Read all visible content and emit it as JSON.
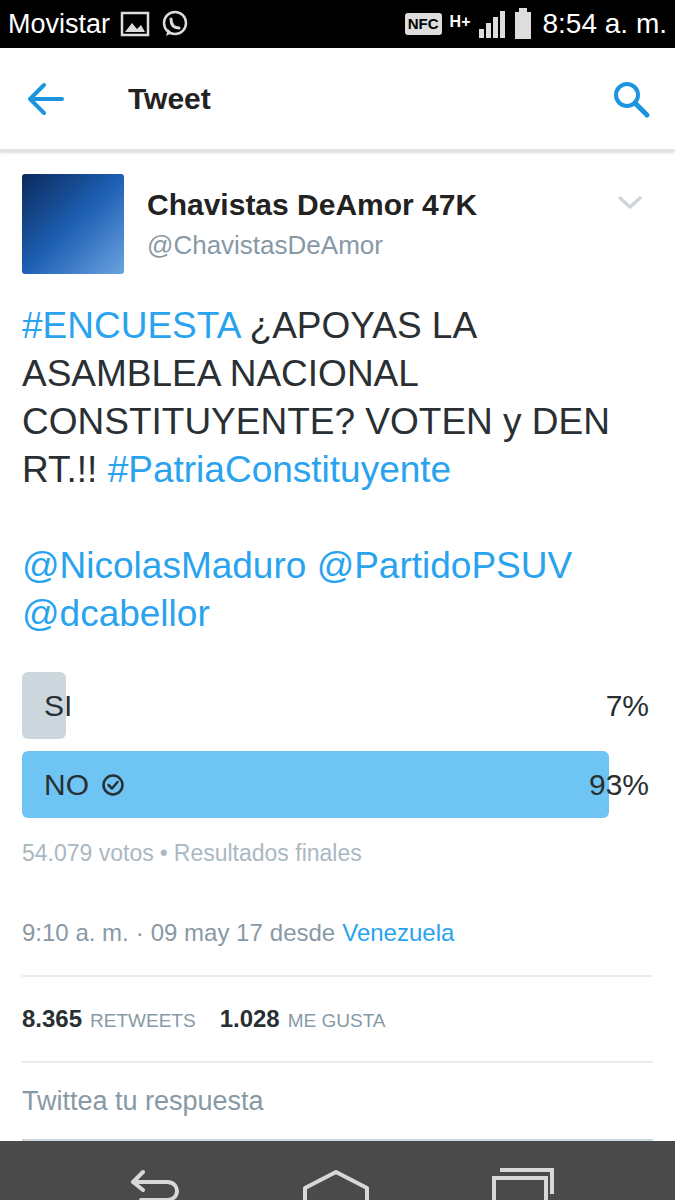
{
  "status_bar": {
    "carrier": "Movistar",
    "nfc": "NFC",
    "network": "H+",
    "time": "8:54 a. m."
  },
  "app_bar": {
    "title": "Tweet"
  },
  "tweet": {
    "author": {
      "name": "Chavistas DeAmor 47K",
      "handle": "@ChavistasDeAmor"
    },
    "paragraphs": [
      [
        {
          "text": "#ENCUESTA",
          "kind": "hashtag"
        },
        {
          "text": " ¿APOYAS LA ASAMBLEA NACIONAL CONSTITUYENTE? VOTEN y DEN RT.!! ",
          "kind": "plain"
        },
        {
          "text": "#PatriaConstituyente",
          "kind": "hashtag"
        }
      ],
      [
        {
          "text": "@NicolasMaduro",
          "kind": "mention"
        },
        {
          "text": " ",
          "kind": "plain"
        },
        {
          "text": "@PartidoPSUV",
          "kind": "mention"
        },
        {
          "text": " ",
          "kind": "plain"
        },
        {
          "text": "@dcabellor",
          "kind": "mention"
        }
      ]
    ],
    "poll": {
      "options": [
        {
          "label": "SI",
          "percent": "7%",
          "level": 0.07,
          "selected": false
        },
        {
          "label": "NO",
          "percent": "93%",
          "level": 0.93,
          "selected": true
        }
      ],
      "votes": "54.079 votos",
      "separator": "•",
      "status": "Resultados finales"
    },
    "timestamp": {
      "time": "9:10 a. m.",
      "separator": "·",
      "date": "09 may 17",
      "via": "desde",
      "location": "Venezuela"
    },
    "stats": [
      {
        "count": "8.365",
        "label": "RETWEETS"
      },
      {
        "count": "1.028",
        "label": "ME GUSTA"
      }
    ]
  },
  "reply": {
    "placeholder": "Twittea tu respuesta"
  }
}
